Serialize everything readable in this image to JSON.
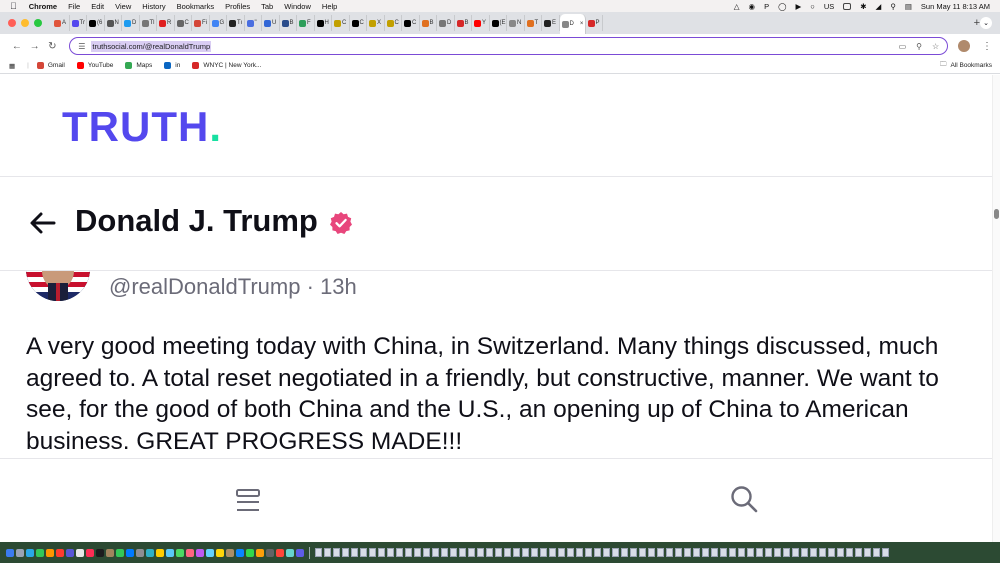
{
  "menubar": {
    "app_name": "Chrome",
    "menus": [
      "File",
      "Edit",
      "View",
      "History",
      "Bookmarks",
      "Profiles",
      "Tab",
      "Window",
      "Help"
    ],
    "status_letter": "P",
    "input_source": "US",
    "datetime": "Sun May 11  8:13 AM"
  },
  "tabs": [
    {
      "label": "A",
      "color": "#e0553c"
    },
    {
      "label": "Tr",
      "color": "#5448ee"
    },
    {
      "label": "(6",
      "color": "#000000"
    },
    {
      "label": "N",
      "color": "#555555"
    },
    {
      "label": "D",
      "color": "#1d9bf0"
    },
    {
      "label": "Tl",
      "color": "#777777"
    },
    {
      "label": "R",
      "color": "#e02020"
    },
    {
      "label": "C",
      "color": "#666666"
    },
    {
      "label": "Fi",
      "color": "#d44638"
    },
    {
      "label": "G",
      "color": "#4285f4"
    },
    {
      "label": "Tı",
      "color": "#222222"
    },
    {
      "label": "\"",
      "color": "#4a6ee0"
    },
    {
      "label": "U",
      "color": "#3367d6"
    },
    {
      "label": "B",
      "color": "#2b4d8c"
    },
    {
      "label": "F",
      "color": "#2e9e5b"
    },
    {
      "label": "H",
      "color": "#000000"
    },
    {
      "label": "C",
      "color": "#c2a000"
    },
    {
      "label": "C",
      "color": "#000000"
    },
    {
      "label": "X",
      "color": "#c2a000"
    },
    {
      "label": "C",
      "color": "#c2a000"
    },
    {
      "label": "C",
      "color": "#000000"
    },
    {
      "label": "B",
      "color": "#e07020"
    },
    {
      "label": "D",
      "color": "#777777"
    },
    {
      "label": "B",
      "color": "#d62828"
    },
    {
      "label": "Y",
      "color": "#ff0000"
    },
    {
      "label": "(E",
      "color": "#000000"
    },
    {
      "label": "N",
      "color": "#888888"
    },
    {
      "label": "T",
      "color": "#e07020"
    },
    {
      "label": "E",
      "color": "#222222"
    },
    {
      "label": "D",
      "color": "#ffffff",
      "active": true
    },
    {
      "label": "P",
      "color": "#d62828"
    }
  ],
  "address_bar": {
    "url": "truthsocial.com/@realDonaldTrump"
  },
  "bookmarks": [
    {
      "label": "Gmail",
      "color": "#d44638"
    },
    {
      "label": "YouTube",
      "color": "#ff0000"
    },
    {
      "label": "Maps",
      "color": "#34a853"
    },
    {
      "label": "in",
      "color": "#0a66c2"
    },
    {
      "label": "WNYC | New York...",
      "color": "#d62828"
    }
  ],
  "all_bookmarks_label": "All Bookmarks",
  "site": {
    "logo_text": "TRUTH",
    "logo_dot": ".",
    "logo_color": "#5448ee",
    "logo_dot_color": "#17e0a1",
    "verified_color": "#e8467c"
  },
  "profile": {
    "display_name": "Donald J. Trump",
    "handle": "@realDonaldTrump",
    "separator": "·",
    "timestamp": "13h"
  },
  "post": {
    "text": "A very good meeting today with China, in Switzerland. Many things discussed, much agreed to. A total reset negotiated in a friendly, but constructive, manner. We want to see, for the good of both China and the U.S., an opening up of China to American business. GREAT PROGRESS MADE!!!"
  },
  "icons": {
    "back": "arrow-left-icon",
    "verified": "verified-badge-icon",
    "menu": "menu-icon",
    "search": "search-icon"
  }
}
